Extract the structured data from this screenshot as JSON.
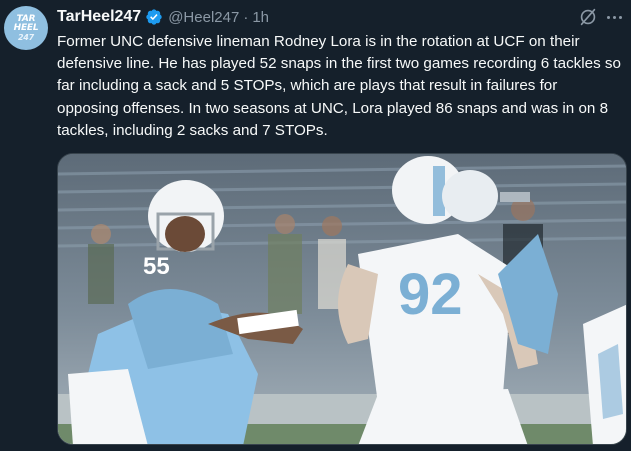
{
  "tweet": {
    "author_name": "TarHeel247",
    "handle": "@Heel247",
    "separator": "·",
    "time": "1h",
    "avatar_text": [
      "TAR",
      "HEEL",
      "247"
    ],
    "text": "Former UNC defensive lineman Rodney Lora is in the rotation at UCF on their defensive line. He has played 52 snaps in the first two games recording 6 tackles so far including a sack and 5 STOPs, which are plays that result in failures for opposing offenses. In two seasons at UNC, Lora played 86 snaps and was in on 8 tackles, including 2 sacks and 7 STOPs.",
    "media": {
      "jersey_left": "55",
      "jersey_right": "92"
    }
  },
  "icons": {
    "verified": "verified-badge-icon",
    "grok": "grok-icon",
    "more": "more-icon"
  },
  "colors": {
    "background": "#15202b",
    "text": "#f7f9f9",
    "muted": "#8b98a5",
    "verified": "#1d9bf0",
    "carolina_blue": "#7bafd4"
  }
}
